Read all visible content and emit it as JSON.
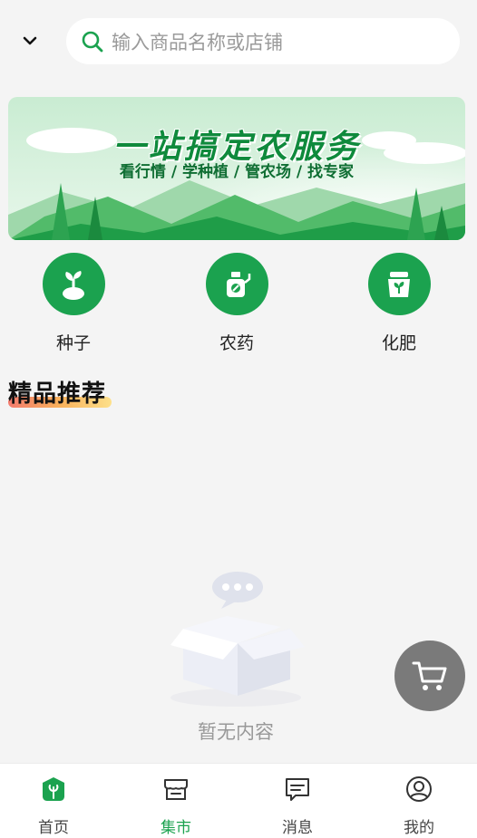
{
  "header": {
    "dropdown_icon": "chevron-down-icon",
    "search": {
      "placeholder": "输入商品名称或店铺",
      "icon": "search-icon"
    }
  },
  "banner": {
    "title": "一站搞定农服务",
    "subtitle": "看行情 / 学种植 / 管农场 / 找专家"
  },
  "categories": [
    {
      "label": "种子",
      "icon": "seed-icon"
    },
    {
      "label": "农药",
      "icon": "pesticide-icon"
    },
    {
      "label": "化肥",
      "icon": "fertilizer-icon"
    }
  ],
  "section": {
    "title": "精品推荐"
  },
  "empty_state": {
    "text": "暂无内容",
    "icon": "empty-box-icon"
  },
  "cart": {
    "icon": "cart-icon"
  },
  "tabbar": {
    "active_index": 1,
    "items": [
      {
        "label": "首页",
        "icon": "home-icon"
      },
      {
        "label": "集市",
        "icon": "store-icon"
      },
      {
        "label": "消息",
        "icon": "message-icon"
      },
      {
        "label": "我的",
        "icon": "user-icon"
      }
    ]
  },
  "colors": {
    "accent": "#1ba24f",
    "cart_button": "#7a7a7a",
    "background": "#f4f4f4"
  }
}
